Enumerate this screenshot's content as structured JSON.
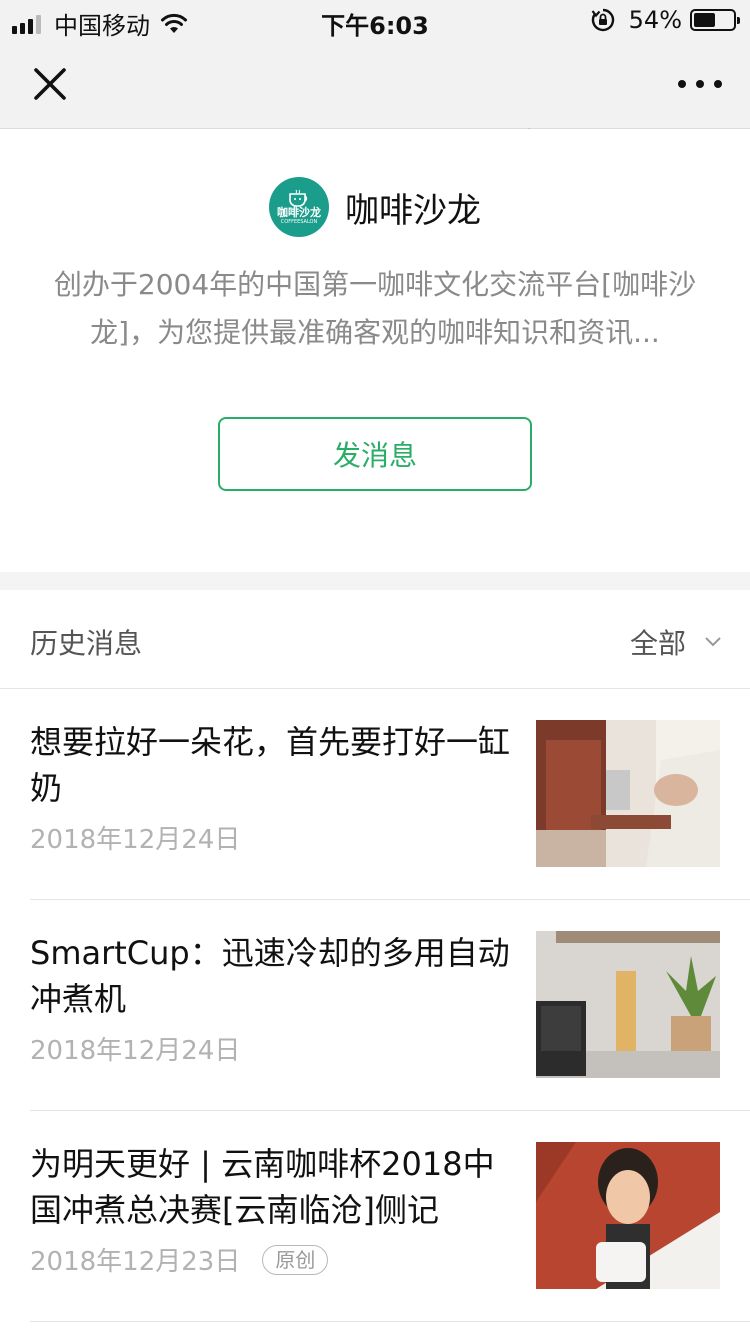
{
  "status_bar": {
    "carrier": "中国移动",
    "time": "下午6:03",
    "battery_percent": "54%",
    "battery_level": 0.54
  },
  "nav": {
    "close_icon": "close-icon",
    "more_icon": "more-icon"
  },
  "account": {
    "name": "咖啡沙龙",
    "logo_text": "咖啡沙龙",
    "logo_subtext": "COFFEESALON",
    "description": "创办于2004年的中国第一咖啡文化交流平台[咖啡沙龙]，为您提供最准确客观的咖啡知识和资讯...",
    "send_message_label": "发消息"
  },
  "history": {
    "title": "历史消息",
    "filter_label": "全部"
  },
  "articles": [
    {
      "title": "想要拉好一朵花，首先要打好一缸奶",
      "date": "2018年12月24日",
      "badge": ""
    },
    {
      "title": "SmartCup：迅速冷却的多用自动冲煮机",
      "date": "2018年12月24日",
      "badge": ""
    },
    {
      "title": "为明天更好 | 云南咖啡杯2018中国冲煮总决赛[云南临沧]侧记",
      "date": "2018年12月23日",
      "badge": "原创"
    }
  ],
  "colors": {
    "accent_green": "#2aae67",
    "logo_teal": "#1b9d8c",
    "annotation_red": "#e8141c"
  }
}
